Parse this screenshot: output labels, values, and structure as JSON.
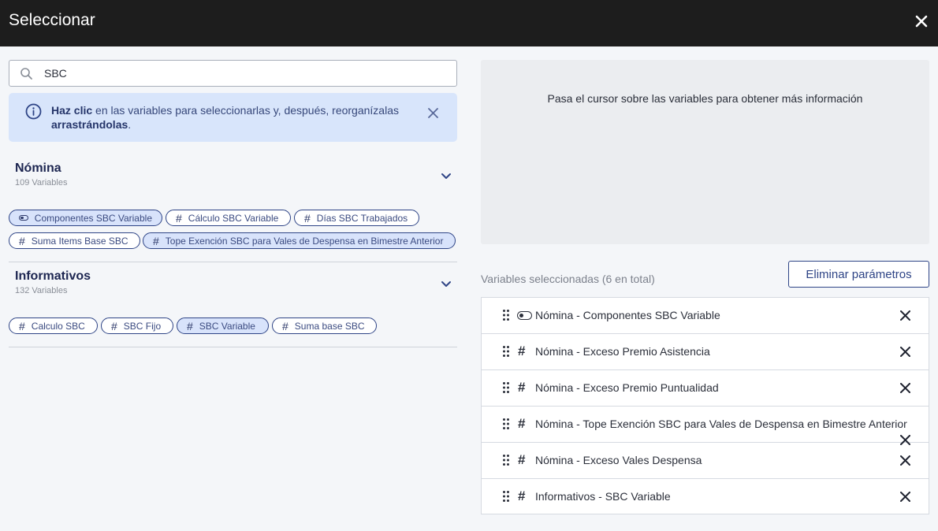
{
  "header": {
    "title": "Seleccionar"
  },
  "search": {
    "value": "SBC"
  },
  "banner": {
    "bold": "Haz clic",
    "text1": " en las variables para seleccionarlas y, después, reorganízalas ",
    "bold2": "arrastrándolas",
    "text2": "."
  },
  "groups": [
    {
      "title": "Nómina",
      "count": "109 Variables",
      "chips": [
        {
          "label": "Componentes SBC Variable",
          "icon": "toggle-icon",
          "selected": true
        },
        {
          "label": "Cálculo SBC Variable",
          "icon": "hash-icon",
          "selected": false
        },
        {
          "label": "Días SBC Trabajados",
          "icon": "hash-icon",
          "selected": false
        },
        {
          "label": "Suma Items Base SBC",
          "icon": "hash-icon",
          "selected": false
        },
        {
          "label": "Tope Exención SBC para Vales de Despensa en Bimestre Anterior",
          "icon": "hash-icon",
          "selected": true
        }
      ]
    },
    {
      "title": "Informativos",
      "count": "132 Variables",
      "chips": [
        {
          "label": "Calculo SBC",
          "icon": "hash-icon",
          "selected": false
        },
        {
          "label": "SBC Fijo",
          "icon": "hash-icon",
          "selected": false
        },
        {
          "label": "SBC Variable",
          "icon": "hash-icon",
          "selected": true
        },
        {
          "label": "Suma base SBC",
          "icon": "hash-icon",
          "selected": false
        }
      ]
    }
  ],
  "info_panel": {
    "text": "Pasa el cursor sobre las variables para obtener más información"
  },
  "selected": {
    "label": "Variables seleccionadas (6 en total)",
    "remove_label": "Eliminar parámetros",
    "items": [
      {
        "label": "Nómina - Componentes SBC Variable",
        "icon": "toggle-icon"
      },
      {
        "label": "Nómina - Exceso Premio Asistencia",
        "icon": "hash-icon"
      },
      {
        "label": "Nómina - Exceso Premio Puntualidad",
        "icon": "hash-icon"
      },
      {
        "label": "Nómina - Tope Exención SBC para Vales de Despensa en Bimestre Anterior",
        "icon": "hash-icon"
      },
      {
        "label": "Nómina - Exceso Vales Despensa",
        "icon": "hash-icon"
      },
      {
        "label": "Informativos - SBC Variable",
        "icon": "hash-icon"
      }
    ]
  },
  "colors": {
    "header_bg": "#1d1d1d",
    "accent": "#2e4486",
    "chip_selected": "#d8e3fb",
    "banner_bg": "#d8e5fb"
  }
}
